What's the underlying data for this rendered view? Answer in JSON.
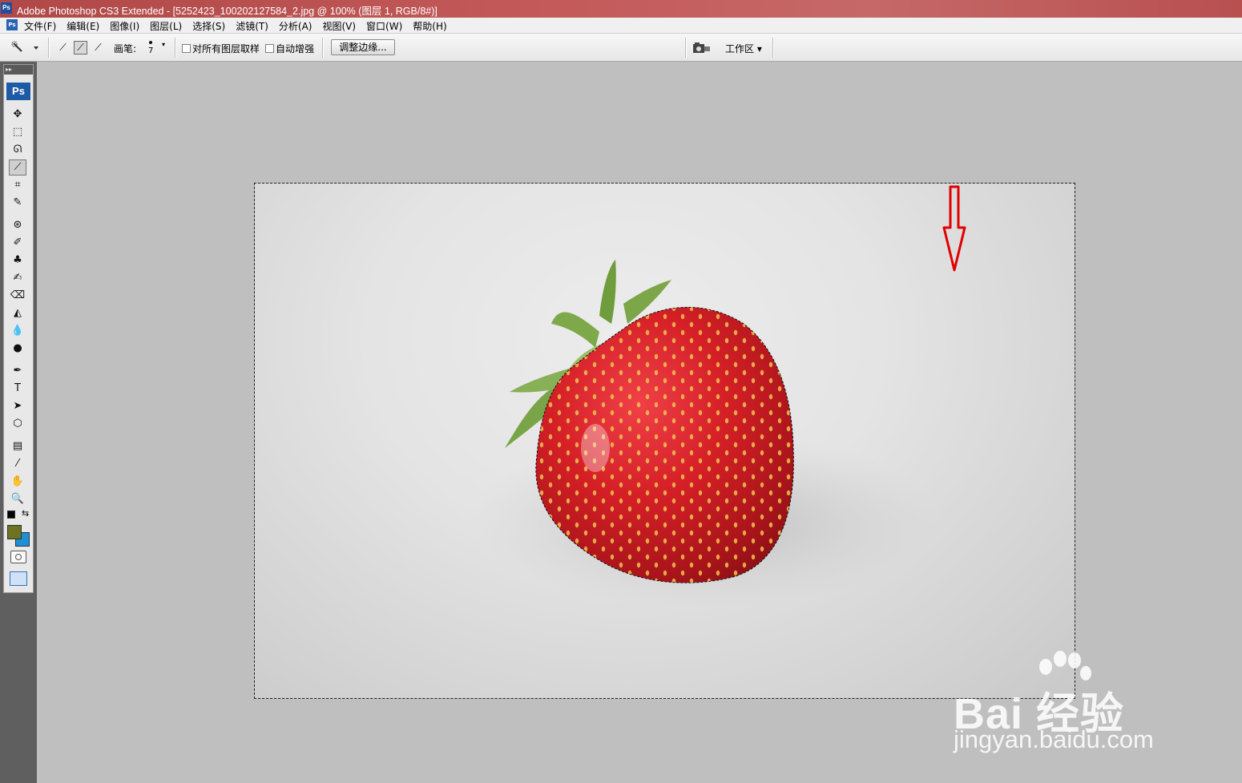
{
  "window": {
    "app_icon": "Ps",
    "title": "Adobe Photoshop CS3 Extended - [5252423_100202127584_2.jpg @ 100% (图层 1, RGB/8#)]"
  },
  "menubar": {
    "doc_icon": "Ps",
    "items": [
      "文件(F)",
      "编辑(E)",
      "图像(I)",
      "图层(L)",
      "选择(S)",
      "滤镜(T)",
      "分析(A)",
      "视图(V)",
      "窗口(W)",
      "帮助(H)"
    ]
  },
  "options": {
    "brush_label": "画笔:",
    "brush_size": "7",
    "sample_all_layers": "对所有图层取样",
    "auto_enhance": "自动增强",
    "refine_edge": "调整边缘...",
    "workspace": "工作区 ▾"
  },
  "toolbox": {
    "logo": "Ps",
    "grip": "▸▸",
    "tools": [
      {
        "name": "move-tool-icon",
        "glyph": "✥"
      },
      {
        "name": "marquee-tool-icon",
        "glyph": "⬚"
      },
      {
        "name": "lasso-tool-icon",
        "glyph": "ᘏ"
      },
      {
        "name": "quick-selection-tool-icon",
        "glyph": "⟋"
      },
      {
        "name": "crop-tool-icon",
        "glyph": "⌗"
      },
      {
        "name": "slice-tool-icon",
        "glyph": "✎"
      },
      {
        "name": "healing-brush-icon",
        "glyph": "⊛"
      },
      {
        "name": "brush-tool-icon",
        "glyph": "✐"
      },
      {
        "name": "clone-stamp-icon",
        "glyph": "♣"
      },
      {
        "name": "history-brush-icon",
        "glyph": "✍"
      },
      {
        "name": "eraser-tool-icon",
        "glyph": "⌫"
      },
      {
        "name": "paint-bucket-icon",
        "glyph": "◭"
      },
      {
        "name": "blur-tool-icon",
        "glyph": "💧"
      },
      {
        "name": "dodge-tool-icon",
        "glyph": "●"
      },
      {
        "name": "pen-tool-icon",
        "glyph": "✒"
      },
      {
        "name": "type-tool-icon",
        "glyph": "T"
      },
      {
        "name": "path-selection-icon",
        "glyph": "➤"
      },
      {
        "name": "shape-tool-icon",
        "glyph": "⬡"
      },
      {
        "name": "notes-tool-icon",
        "glyph": "▤"
      },
      {
        "name": "eyedropper-icon",
        "glyph": "⁄"
      },
      {
        "name": "hand-tool-icon",
        "glyph": "✋"
      },
      {
        "name": "zoom-tool-icon",
        "glyph": "🔍"
      }
    ],
    "fg_color": "#6f7221",
    "bg_color": "#1c8fd6"
  },
  "watermark": {
    "brand": "Bai 经验",
    "url": "jingyan.baidu.com"
  },
  "colors": {
    "titlebar": "#c05a5a",
    "canvas_bg": "#e4e4e4",
    "strawberry": "#d8222a",
    "arrow": "#e00000"
  }
}
